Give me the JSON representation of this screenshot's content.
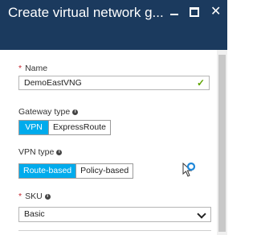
{
  "window": {
    "title": "Create virtual network g...",
    "min_icon": "minimize-icon",
    "max_icon": "maximize-icon",
    "close_icon": "close-icon"
  },
  "form": {
    "name": {
      "label": "Name",
      "required_marker": "*",
      "value": "DemoEastVNG",
      "status_icon": "check-icon"
    },
    "gateway_type": {
      "label": "Gateway type",
      "info_icon": "info-icon",
      "options": [
        "VPN",
        "ExpressRoute"
      ],
      "selected": "VPN"
    },
    "vpn_type": {
      "label": "VPN type",
      "info_icon": "info-icon",
      "options": [
        "Route-based",
        "Policy-based"
      ],
      "selected": "Route-based"
    },
    "sku": {
      "label": "SKU",
      "required_marker": "*",
      "info_icon": "info-icon",
      "selected": "Basic"
    }
  },
  "colors": {
    "titlebar": "#1b3a5e",
    "toggle_active": "#00abec",
    "required": "#c4262e",
    "valid_check": "#5ea400"
  }
}
